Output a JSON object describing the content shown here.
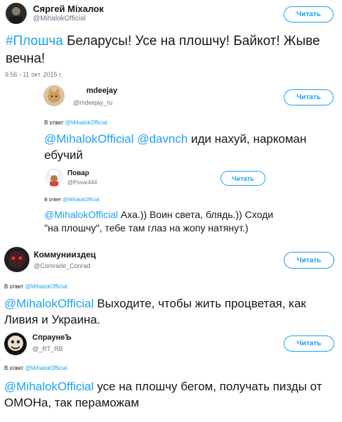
{
  "follow_label": "Читать",
  "reply_prefix": "В ответ",
  "reply_target": "@MihalokOfficial",
  "main": {
    "name": "Сяргей Міхалок",
    "handle": "@MihalokOfficial",
    "hashtag": "#Плошча",
    "text": " Беларусы! Усе на плошчу! Байкот! Жыве вечна!",
    "timestamp": "9:56 - 11 окт. 2015 г."
  },
  "replies": [
    {
      "name": "mdeejay",
      "handle": "@mdeejay_ru",
      "mentions": "@MihalokOfficial @davnch",
      "text": " иди нахуй, наркоман ебучий"
    },
    {
      "name": "Повар",
      "handle": "@Povar444",
      "mentions": "@MihalokOfficial",
      "text": " Аха.)) Воин света, блядь.)) Сходи \"на плошчу\", тебе там глаз на жопу натянут.)"
    },
    {
      "name": "Коммунииздец",
      "handle": "@Comrade_Conrad",
      "mentions": "@MihalokOfficial",
      "text": " Выходите, чтобы жить процветая, как Ливия и Украина."
    },
    {
      "name": "СпраунеЪ",
      "handle": "@_RT_RB",
      "mentions": "@MihalokOfficial",
      "text": " усе на плошчу бегом,  получать пизды от ОМОНа,  так пераможам"
    }
  ]
}
